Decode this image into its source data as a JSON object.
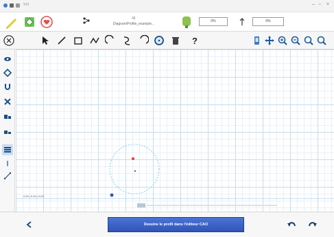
{
  "titlebar": {
    "app_name": "VVI",
    "minimize": "–",
    "maximize": "▫",
    "close": "×"
  },
  "file": {
    "index": "41",
    "name": "Diagram/Profile_example..."
  },
  "inputs": {
    "first_value": "0%",
    "second_value": "0%"
  },
  "canvas": {
    "coordinates": "0.00 | 0.00 | 0.00"
  },
  "banner": {
    "label": "Dessine le profil dans l'éditeur CAO"
  },
  "icons": {
    "top": [
      "pencil-icon",
      "move-diamond-icon",
      "heart-icon",
      "share-icon",
      "shield-tag-icon",
      "unit-icon"
    ],
    "draw": [
      "close-circle-icon",
      "pointer-icon",
      "line-icon",
      "rectangle-icon",
      "polyline-icon",
      "arc-icon",
      "curve-icon",
      "arc-reverse-icon",
      "circle-icon",
      "trash-icon",
      "help-icon",
      "phone-icon",
      "pan-icon",
      "zoom-in-icon",
      "zoom-out-icon",
      "zoom-fit-icon"
    ],
    "left": [
      "eye-icon",
      "node-icon",
      "magnet-icon",
      "delete-x-icon",
      "layers-a-icon",
      "layers-b-icon",
      "grid-icon",
      "pin-icon",
      "measure-icon"
    ],
    "bottom": [
      "back-arrow-icon",
      "undo-icon",
      "redo-icon"
    ]
  },
  "colors": {
    "accent_blue": "#2f55b8",
    "grid": "#c7dcea",
    "circle": "#7fd0e6",
    "red_point": "#e8343d"
  }
}
